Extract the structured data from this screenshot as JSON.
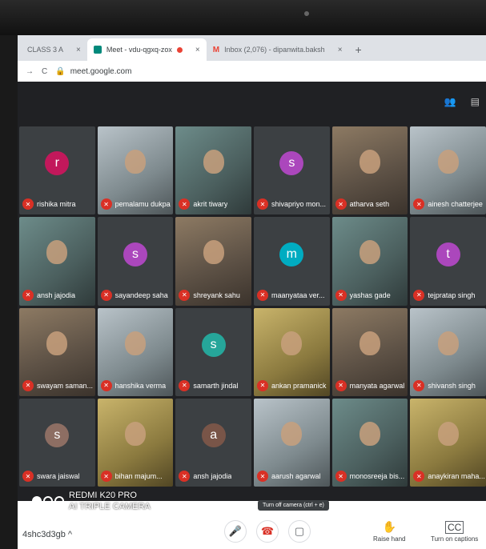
{
  "browser": {
    "tabs": [
      {
        "title": "CLASS 3 A",
        "close": "×"
      },
      {
        "title": "Meet - vdu-qgxq-zox",
        "close": "×"
      },
      {
        "title": "Inbox (2,076) - dipanwita.baksh",
        "close": "×"
      }
    ],
    "new_tab": "+",
    "url": "meet.google.com"
  },
  "participants": [
    {
      "name": "rishika mitra",
      "avatar": "r",
      "avatar_color": "#c2185b",
      "video": false
    },
    {
      "name": "pemalamu dukpa",
      "video": true
    },
    {
      "name": "akrit tiwary",
      "video": true
    },
    {
      "name": "shivapriyo mon...",
      "avatar": "s",
      "avatar_color": "#ab47bc",
      "video": false
    },
    {
      "name": "atharva seth",
      "video": true
    },
    {
      "name": "ainesh chatterjee",
      "video": true
    },
    {
      "name": "ansh jajodia",
      "video": true
    },
    {
      "name": "sayandeep saha",
      "avatar": "s",
      "avatar_color": "#ab47bc",
      "video": false
    },
    {
      "name": "shreyank sahu",
      "video": true
    },
    {
      "name": "maanyataa ver...",
      "avatar": "m",
      "avatar_color": "#00acc1",
      "video": false
    },
    {
      "name": "yashas gade",
      "video": true
    },
    {
      "name": "tejpratap singh",
      "avatar": "t",
      "avatar_color": "#ab47bc",
      "video": false
    },
    {
      "name": "swayam saman...",
      "video": true
    },
    {
      "name": "hanshika verma",
      "video": true
    },
    {
      "name": "samarth jindal",
      "avatar": "s",
      "avatar_color": "#26a69a",
      "video": false
    },
    {
      "name": "ankan pramanick",
      "video": true
    },
    {
      "name": "manyata agarwal",
      "video": true
    },
    {
      "name": "shivansh singh",
      "video": true
    },
    {
      "name": "swara jaiswal",
      "avatar": "s",
      "avatar_color": "#8d6e63",
      "video": false
    },
    {
      "name": "bihan majum...",
      "video": true
    },
    {
      "name": "ansh jajodia",
      "avatar": "a",
      "avatar_color": "#795548",
      "video": false
    },
    {
      "name": "aarush agarwal",
      "video": true
    },
    {
      "name": "monosreeja bis...",
      "video": true
    },
    {
      "name": "anaykiran maha...",
      "video": true
    }
  ],
  "controls": {
    "meeting_code": "4shc3d3gb",
    "meeting_code_chevron": "^",
    "tooltip": "Turn off camera (ctrl + e)",
    "raise_hand": "Raise hand",
    "captions": "Turn on captions"
  },
  "watermark": {
    "line1": "REDMI K20 PRO",
    "line2": "AI TRIPLE CAMERA"
  },
  "icons": {
    "mic_off": "mic-off-icon",
    "people": "people-icon",
    "chat": "chat-icon",
    "microphone": "microphone-icon",
    "end_call": "end-call-icon",
    "camera": "camera-icon",
    "hand": "hand-icon",
    "captions": "captions-icon"
  }
}
